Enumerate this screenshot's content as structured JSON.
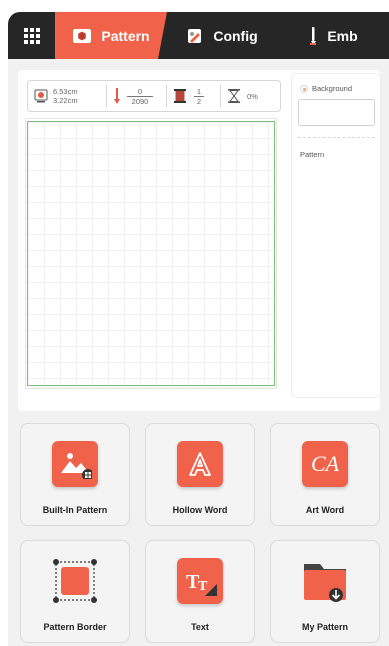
{
  "nav": {
    "tabs": [
      {
        "label": "Pattern",
        "icon": "pattern-icon",
        "active": true
      },
      {
        "label": "Config",
        "icon": "config-icon",
        "active": false
      },
      {
        "label": "Emb",
        "icon": "needle-icon",
        "active": false
      }
    ]
  },
  "stats": {
    "width": "6.53cm",
    "height": "3.22cm",
    "stitches_done": "0",
    "stitches_total": "2090",
    "color_current": "1",
    "color_total": "2",
    "progress": "0%"
  },
  "side_panel": {
    "background_label": "Background",
    "pattern_label": "Pattern"
  },
  "tools": [
    {
      "label": "Built-In Pattern",
      "icon": "built-in-pattern-icon"
    },
    {
      "label": "Hollow Word",
      "icon": "hollow-word-icon"
    },
    {
      "label": "Art Word",
      "icon": "art-word-icon"
    },
    {
      "label": "Pattern Border",
      "icon": "pattern-border-icon"
    },
    {
      "label": "Text",
      "icon": "text-icon"
    },
    {
      "label": "My Pattern",
      "icon": "my-pattern-icon"
    }
  ],
  "colors": {
    "accent": "#f0624a",
    "topbar": "#262626",
    "canvas_border": "#79c27a"
  }
}
